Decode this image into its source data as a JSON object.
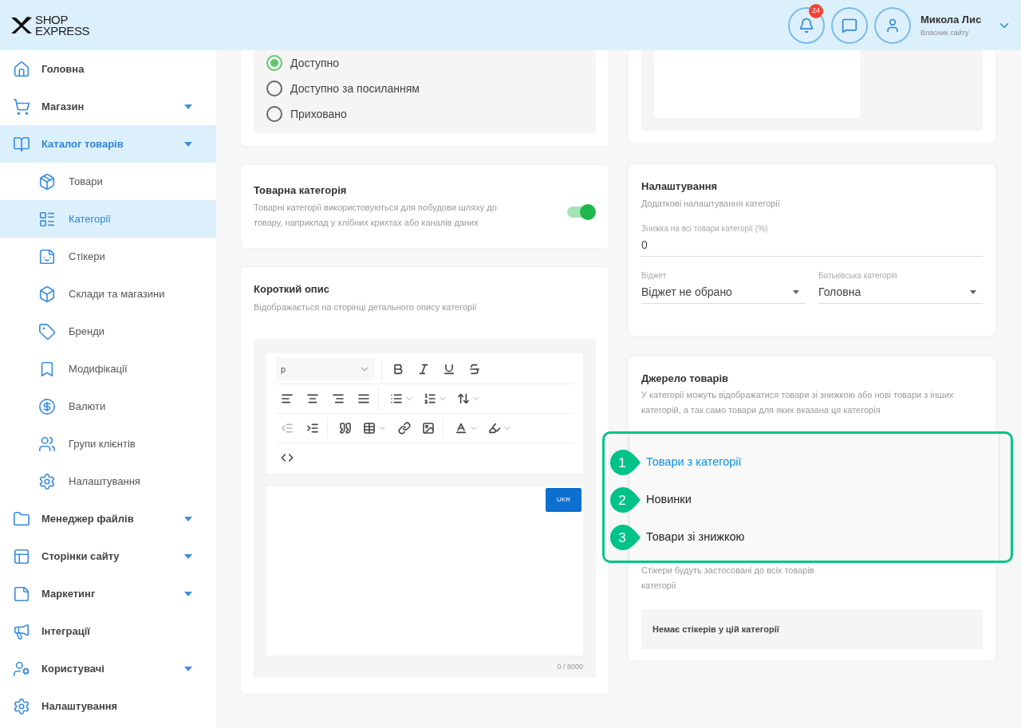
{
  "header": {
    "logo": {
      "line1": "SHOP",
      "line2": "EXPRESS"
    },
    "notifications_badge": "24",
    "user": {
      "name": "Микола Лис",
      "role": "Власник сайту"
    }
  },
  "sidebar": {
    "items": [
      {
        "label": "Головна",
        "submenu": false,
        "selected": false
      },
      {
        "label": "Магазин",
        "submenu": true,
        "selected": false
      },
      {
        "label": "Каталог товарів",
        "submenu": true,
        "selected": true,
        "children": [
          {
            "label": "Товари",
            "selected": false
          },
          {
            "label": "Категорії",
            "selected": true
          },
          {
            "label": "Стікери",
            "selected": false
          },
          {
            "label": "Склади та магазини",
            "selected": false
          },
          {
            "label": "Бренди",
            "selected": false
          },
          {
            "label": "Модифікації",
            "selected": false
          },
          {
            "label": "Валюти",
            "selected": false
          },
          {
            "label": "Групи клієнтів",
            "selected": false
          },
          {
            "label": "Налаштування",
            "selected": false
          }
        ]
      },
      {
        "label": "Менеджер файлів",
        "submenu": true,
        "selected": false
      },
      {
        "label": "Сторінки сайту",
        "submenu": true,
        "selected": false
      },
      {
        "label": "Маркетинг",
        "submenu": true,
        "selected": false
      },
      {
        "label": "Інтеграції",
        "submenu": false,
        "selected": false
      },
      {
        "label": "Користувачі",
        "submenu": true,
        "selected": false
      },
      {
        "label": "Налаштування",
        "submenu": false,
        "selected": false
      }
    ]
  },
  "visibility": {
    "options": [
      {
        "label": "Доступно",
        "selected": true
      },
      {
        "label": "Доступно за посиланням",
        "selected": false
      },
      {
        "label": "Приховано",
        "selected": false
      }
    ]
  },
  "product_category": {
    "title": "Товарна категорія",
    "description": "Товарні категорії використовуються для побудови шляху до товару, наприклад у хлібних крихтах або каналів даних",
    "on": true
  },
  "short_description": {
    "title": "Короткий опис",
    "description": "Відображається на сторінці детального опису категорії",
    "format_select": "p",
    "language_button": "UKR",
    "counter": "0 / 8000"
  },
  "settings": {
    "title": "Налаштування",
    "description": "Додаткові налаштування категорії",
    "discount": {
      "label": "Знижка на всі товари категорії (%)",
      "value": "0"
    },
    "widget": {
      "label": "Віджет",
      "value": "Віджет не обрано"
    },
    "parent": {
      "label": "Батьківська категорія",
      "value": "Головна"
    }
  },
  "product_source": {
    "title": "Джерело товарів",
    "description": "У категорії можуть відображатися товари зі знижкою або нові товари з інших категорій, а так само товари для яких вказана ця категорія",
    "options": [
      {
        "marker": "1",
        "label": "Товари з категорії",
        "selected": true
      },
      {
        "marker": "2",
        "label": "Новинки",
        "selected": false
      },
      {
        "marker": "3",
        "label": "Товари зі знижкою",
        "selected": false
      }
    ],
    "stickers_note": "Стікери будуть застосовані до всіх товарів категорії",
    "stickers_empty": "Немає стікерів у цій категорії"
  }
}
